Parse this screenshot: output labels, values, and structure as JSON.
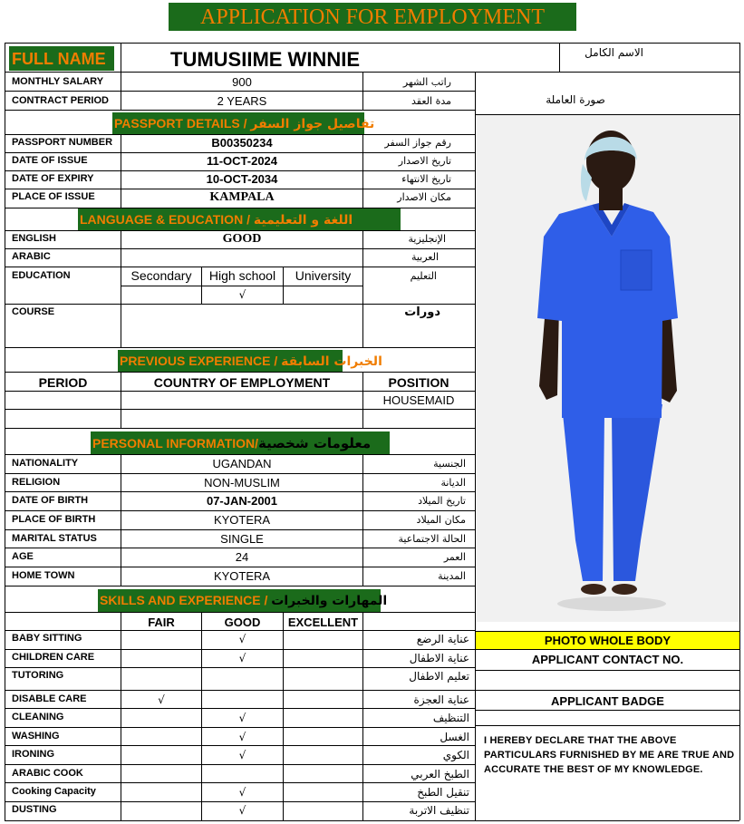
{
  "title": "APPLICATION FOR EMPLOYMENT",
  "full_name": {
    "label": "FULL NAME",
    "value": "TUMUSIIME WINNIE",
    "label_ar": "الاسم الكامل"
  },
  "contract": {
    "monthly_salary": {
      "label": "MONTHLY SALARY",
      "value": "900",
      "label_ar": "راتب الشهر"
    },
    "contract_period": {
      "label": "CONTRACT PERIOD",
      "value": "2 YEARS",
      "label_ar": "مدة العقد"
    }
  },
  "photo_label_ar": "صورة العاملة",
  "passport": {
    "heading": "PASSPORT DETAILS / ",
    "heading_ar": "تفاصيل جواز السفر",
    "number": {
      "label": "PASSPORT NUMBER",
      "value": "B00350234",
      "label_ar": "رقم جواز السفر"
    },
    "issue": {
      "label": "DATE OF ISSUE",
      "value": "11-OCT-2024",
      "label_ar": "تاريخ الاصدار"
    },
    "expiry": {
      "label": "DATE OF EXPIRY",
      "value": "10-OCT-2034",
      "label_ar": "تاريخ الانتهاء"
    },
    "place": {
      "label": "PLACE OF ISSUE",
      "value": "KAMPALA",
      "label_ar": "مكان الاصدار"
    }
  },
  "language": {
    "heading": "LANGUAGE & EDUCATION / ",
    "heading_ar": "اللغة و التعليمية",
    "english": {
      "label": "ENGLISH",
      "value": "GOOD",
      "label_ar": "الإنجليزية"
    },
    "arabic": {
      "label": "ARABIC",
      "value": "",
      "label_ar": "العربية"
    },
    "education": {
      "label": "EDUCATION",
      "label_ar": "التعليم",
      "levels": [
        "Secondary",
        "High school",
        "University"
      ],
      "marks": [
        "",
        "√",
        ""
      ]
    },
    "course": {
      "label": "COURSE",
      "label_ar": "دورات"
    }
  },
  "experience": {
    "heading": "PREVIOUS EXPERIENCE / ",
    "heading_ar": "الخبرات السابقة",
    "columns": [
      "PERIOD",
      "COUNTRY OF EMPLOYMENT",
      "POSITION"
    ],
    "rows": [
      [
        "",
        "",
        "HOUSEMAID"
      ],
      [
        "",
        "",
        ""
      ]
    ]
  },
  "personal": {
    "heading": "PERSONAL INFORMATION/",
    "heading_ar": "معلومات شخصية",
    "rows": [
      {
        "label": "NATIONALITY",
        "value": "UGANDAN",
        "label_ar": "الجنسية",
        "bold": false
      },
      {
        "label": "RELIGION",
        "value": "NON-MUSLIM",
        "label_ar": "الديانة",
        "bold": false
      },
      {
        "label": "DATE OF BIRTH",
        "value": "07-JAN-2001",
        "label_ar": "تاريخ الميلاد",
        "bold": true
      },
      {
        "label": "PLACE OF BIRTH",
        "value": "KYOTERA",
        "label_ar": "مكان الميلاد",
        "bold": false
      },
      {
        "label": "MARITAL STATUS",
        "value": "SINGLE",
        "label_ar": "الحالة الاجتماعية",
        "bold": false
      },
      {
        "label": "AGE",
        "value": "24",
        "label_ar": "العمر",
        "bold": false
      },
      {
        "label": "HOME TOWN",
        "value": "KYOTERA",
        "label_ar": "المدينة",
        "bold": false
      }
    ]
  },
  "skills": {
    "heading": "SKILLS AND EXPERIENCE / ",
    "heading_ar": "المهارات والخبرات",
    "levels": [
      "FAIR",
      "GOOD",
      "EXCELLENT"
    ],
    "rows": [
      {
        "label": "BABY SITTING",
        "label_ar": "عناية الرضع",
        "marks": [
          "",
          "√",
          ""
        ]
      },
      {
        "label": "CHILDREN CARE",
        "label_ar": "عناية الاطفال",
        "marks": [
          "",
          "√",
          ""
        ]
      },
      {
        "label": "TUTORING",
        "label_ar": "تعليم الاطفال",
        "marks": [
          "",
          "",
          ""
        ]
      },
      {
        "label": "DISABLE CARE",
        "label_ar": "عناية العجزة",
        "marks": [
          "√",
          "",
          ""
        ]
      },
      {
        "label": "CLEANING",
        "label_ar": "التنظيف",
        "marks": [
          "",
          "√",
          ""
        ]
      },
      {
        "label": "WASHING",
        "label_ar": "الغسل",
        "marks": [
          "",
          "√",
          ""
        ]
      },
      {
        "label": "IRONING",
        "label_ar": "الكوي",
        "marks": [
          "",
          "√",
          ""
        ]
      },
      {
        "label": "ARABIC COOK",
        "label_ar": "الطبخ العربي",
        "marks": [
          "",
          "",
          ""
        ]
      },
      {
        "label": "Cooking Capacity",
        "label_ar": "تنقيل الطبخ",
        "marks": [
          "",
          "√",
          ""
        ]
      },
      {
        "label": "DUSTING",
        "label_ar": "تنظيف الاتربة",
        "marks": [
          "",
          "√",
          ""
        ]
      }
    ]
  },
  "right_panel": {
    "photo_caption": "PHOTO WHOLE BODY",
    "contact": "APPLICANT CONTACT NO.",
    "badge": "APPLICANT BADGE",
    "declaration": "I HEREBY DECLARE THAT THE ABOVE PARTICULARS FURNISHED BY ME ARE TRUE AND ACCURATE THE BEST OF MY KNOWLEDGE."
  },
  "colors": {
    "band_bg": "#1b6b1b",
    "band_text": "#f07d00",
    "caption_bg": "#ffff00",
    "scrub_blue": "#2f5ee8"
  }
}
